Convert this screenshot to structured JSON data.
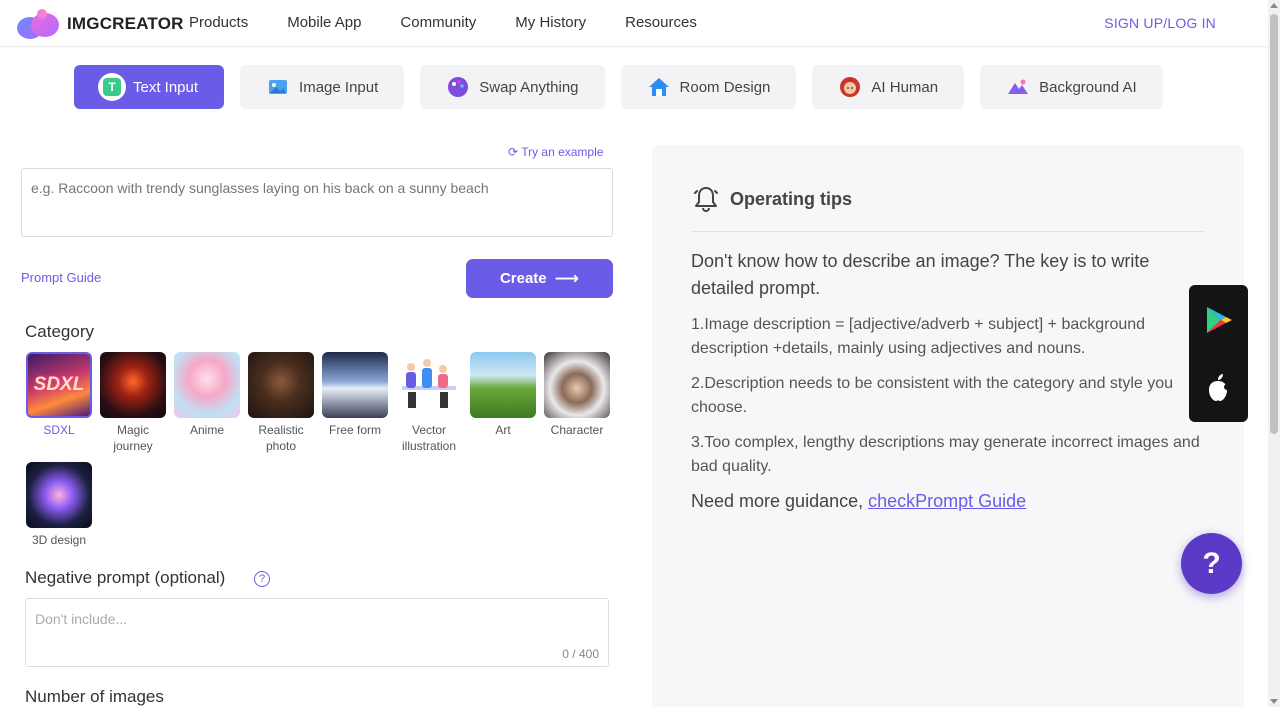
{
  "header": {
    "logo_text": "IMGCREATOR",
    "nav": [
      "Products",
      "Mobile App",
      "Community",
      "My History",
      "Resources"
    ],
    "login_label": "SIGN UP/LOG IN"
  },
  "tabs": [
    {
      "label": "Text Input",
      "icon": "text-input-icon",
      "active": true
    },
    {
      "label": "Image Input",
      "icon": "image-icon"
    },
    {
      "label": "Swap Anything",
      "icon": "palette-icon"
    },
    {
      "label": "Room Design",
      "icon": "house-icon"
    },
    {
      "label": "AI Human",
      "icon": "face-icon"
    },
    {
      "label": "Background AI",
      "icon": "mountain-icon"
    }
  ],
  "form": {
    "try_example": "Try an example",
    "prompt_placeholder": "e.g. Raccoon with trendy sunglasses laying on his back on a sunny beach",
    "prompt_guide": "Prompt Guide",
    "create_label": "Create",
    "category_title": "Category",
    "negative_title": "Negative prompt (optional)",
    "negative_placeholder": "Don't include...",
    "negative_count": "0 / 400",
    "number_title": "Number of images"
  },
  "categories": [
    {
      "label": "SDXL",
      "selected": true,
      "thumb_text": "SDXL"
    },
    {
      "label": "Magic journey"
    },
    {
      "label": "Anime"
    },
    {
      "label": "Realistic photo"
    },
    {
      "label": "Free form"
    },
    {
      "label": "Vector illustration"
    },
    {
      "label": "Art"
    },
    {
      "label": "Character"
    },
    {
      "label": "3D design"
    }
  ],
  "tips": {
    "title": "Operating tips",
    "lead": "Don't know how to describe an image? The key is to write detailed prompt.",
    "items": [
      "1.Image description = [adjective/adverb + subject] + background description +details, mainly using adjectives and nouns.",
      "2.Description needs to be consistent with the category and style you choose.",
      "3.Too complex, lengthy descriptions may generate incorrect images and bad quality."
    ],
    "more_prefix": "Need more guidance, ",
    "more_link": "checkPrompt Guide"
  },
  "help_label": "?",
  "colors": {
    "accent": "#6b5ce7",
    "help": "#5b3ac8"
  }
}
